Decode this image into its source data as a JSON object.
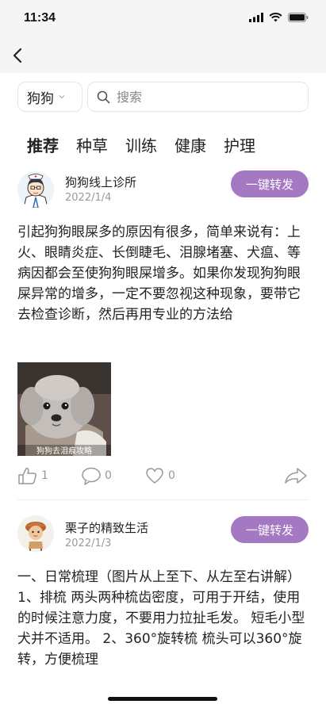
{
  "status": {
    "time": "11:34"
  },
  "search": {
    "dropdown_label": "狗狗",
    "placeholder": "搜索"
  },
  "tabs": [
    {
      "label": "推荐"
    },
    {
      "label": "种草"
    },
    {
      "label": "训练"
    },
    {
      "label": "健康"
    },
    {
      "label": "护理"
    }
  ],
  "posts": [
    {
      "author": "狗狗线上诊所",
      "date": "2022/1/4",
      "share_label": "一键转发",
      "text": "引起狗狗眼屎多的原因有很多，简单来说有：上火、眼睛炎症、长倒睫毛、泪腺堵塞、犬瘟、等病因都会至使狗狗眼屎增多。如果你发现狗狗眼屎异常的增多，一定不要忽视这种现象，要带它去检查诊断，然后再用专业的方法给",
      "image_caption": "狗狗去泪痕攻略",
      "likes": "1",
      "comments": "0",
      "favorites": "0"
    },
    {
      "author": "栗子的精致生活",
      "date": "2022/1/3",
      "share_label": "一键转发",
      "text": "一、日常梳理（图片从上至下、从左至右讲解）1、排梳 两头两种梳齿密度，可用于开结，使用的时候注意力度，不要用力拉扯毛发。 短毛小型犬并不适用。 2、360°旋转梳 梳头可以360°旋转，方便梳理"
    }
  ],
  "colors": {
    "accent": "#a478c2",
    "muted": "#999999"
  }
}
